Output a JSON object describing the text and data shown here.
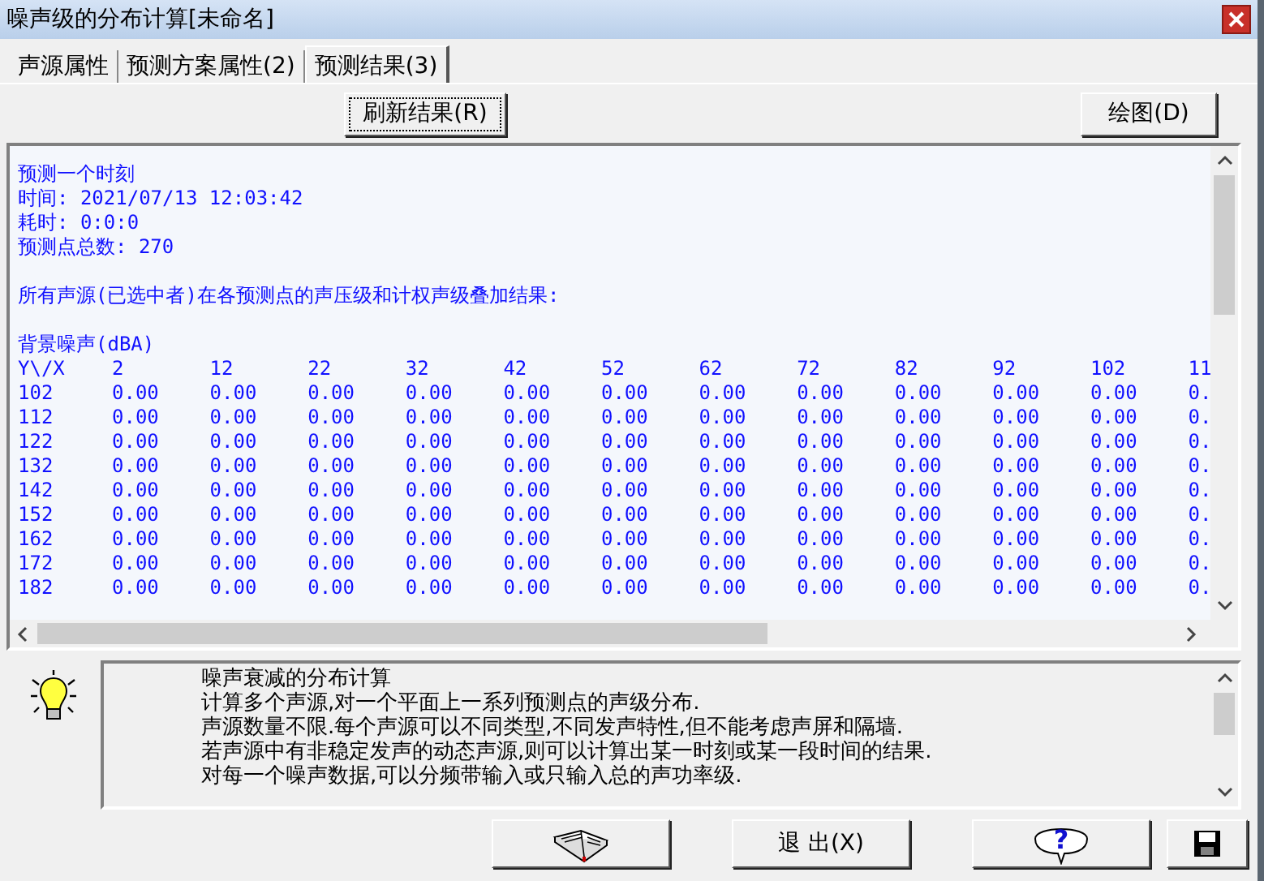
{
  "window": {
    "title": "噪声级的分布计算[未命名]"
  },
  "tabs": [
    {
      "label": "声源属性",
      "selected": false
    },
    {
      "label": "预测方案属性(2)",
      "selected": false
    },
    {
      "label": "预测结果(3)",
      "selected": true
    }
  ],
  "toolbar": {
    "refresh_button": "刷新结果(R)",
    "plot_button": "绘图(D)"
  },
  "results": {
    "header_lines": [
      "预测一个时刻",
      "时间: 2021/07/13 12:03:42",
      "耗时: 0:0:0",
      "预测点总数: 270"
    ],
    "summary": "所有声源(已选中者)在各预测点的声压级和计权声级叠加结果:",
    "section_title": "背景噪声(dBA)",
    "columns": [
      "Y\\/X",
      "2",
      "12",
      "22",
      "32",
      "42",
      "52",
      "62",
      "72",
      "82",
      "92",
      "102",
      "11"
    ],
    "rows": [
      [
        "102",
        "0.00",
        "0.00",
        "0.00",
        "0.00",
        "0.00",
        "0.00",
        "0.00",
        "0.00",
        "0.00",
        "0.00",
        "0.00",
        "0."
      ],
      [
        "112",
        "0.00",
        "0.00",
        "0.00",
        "0.00",
        "0.00",
        "0.00",
        "0.00",
        "0.00",
        "0.00",
        "0.00",
        "0.00",
        "0."
      ],
      [
        "122",
        "0.00",
        "0.00",
        "0.00",
        "0.00",
        "0.00",
        "0.00",
        "0.00",
        "0.00",
        "0.00",
        "0.00",
        "0.00",
        "0."
      ],
      [
        "132",
        "0.00",
        "0.00",
        "0.00",
        "0.00",
        "0.00",
        "0.00",
        "0.00",
        "0.00",
        "0.00",
        "0.00",
        "0.00",
        "0."
      ],
      [
        "142",
        "0.00",
        "0.00",
        "0.00",
        "0.00",
        "0.00",
        "0.00",
        "0.00",
        "0.00",
        "0.00",
        "0.00",
        "0.00",
        "0."
      ],
      [
        "152",
        "0.00",
        "0.00",
        "0.00",
        "0.00",
        "0.00",
        "0.00",
        "0.00",
        "0.00",
        "0.00",
        "0.00",
        "0.00",
        "0."
      ],
      [
        "162",
        "0.00",
        "0.00",
        "0.00",
        "0.00",
        "0.00",
        "0.00",
        "0.00",
        "0.00",
        "0.00",
        "0.00",
        "0.00",
        "0."
      ],
      [
        "172",
        "0.00",
        "0.00",
        "0.00",
        "0.00",
        "0.00",
        "0.00",
        "0.00",
        "0.00",
        "0.00",
        "0.00",
        "0.00",
        "0."
      ],
      [
        "182",
        "0.00",
        "0.00",
        "0.00",
        "0.00",
        "0.00",
        "0.00",
        "0.00",
        "0.00",
        "0.00",
        "0.00",
        "0.00",
        "0."
      ]
    ]
  },
  "info": {
    "title": "噪声衰减的分布计算",
    "lines": [
      "计算多个声源,对一个平面上一系列预测点的声级分布.",
      "声源数量不限.每个声源可以不同类型,不同发声特性,但不能考虑声屏和隔墙.",
      "若声源中有非稳定发声的动态声源,则可以计算出某一时刻或某一段时间的结果.",
      "对每一个噪声数据,可以分频带输入或只输入总的声功率级."
    ]
  },
  "bottom_buttons": [
    {
      "kind": "book"
    },
    {
      "kind": "text",
      "label": "退 出(X)"
    },
    {
      "kind": "help",
      "label": "?"
    },
    {
      "kind": "save"
    }
  ]
}
